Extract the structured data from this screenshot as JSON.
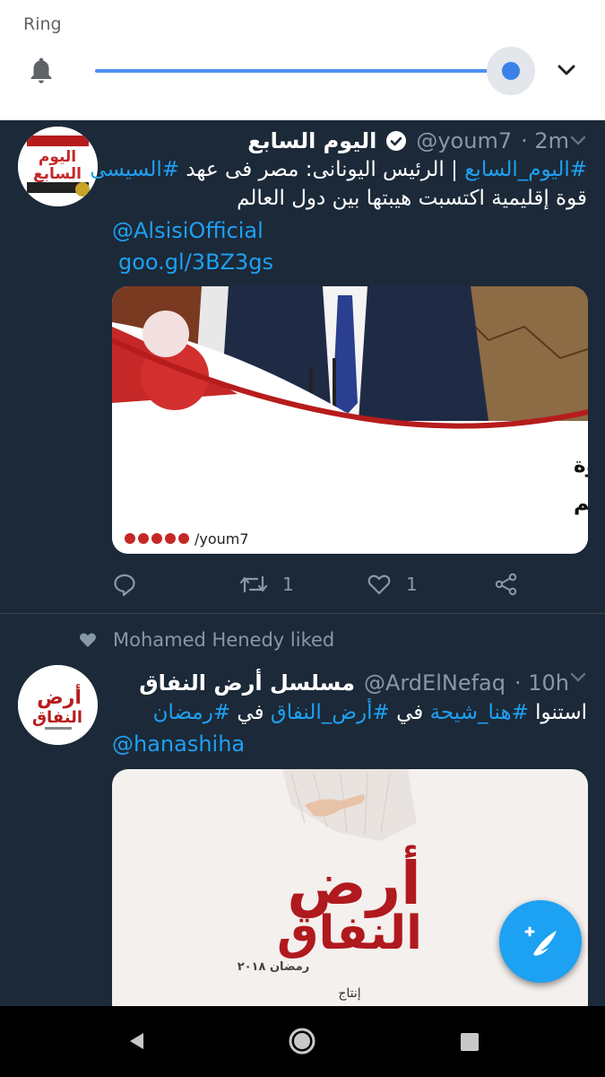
{
  "volume": {
    "label": "Ring",
    "level": 1.0,
    "icons": {
      "bell": "bell-icon",
      "expand": "chevron-down-icon"
    },
    "accent_color": "#3b82e8"
  },
  "tweets": [
    {
      "display_name": "اليوم السابع",
      "verified": true,
      "handle": "@youm7",
      "time": "· 2m",
      "avatar_text_lines": [
        "اليوم",
        "السابع"
      ],
      "hashtag_1": "#اليوم_السابع",
      "text_1": "| الرئيس اليونانى: مصر فى عهد",
      "hashtag_2": "#السيسى",
      "text_line_2": "قوة إقليمية اكتسبت هيبتها بين دول العالم",
      "mention": "@AlsisiOfficial",
      "link": "goo.gl/3BZ3gs",
      "media": {
        "headline_1": "الرئيس اليونانى: مصر فى عهد السيسى قوة",
        "headline_2": "إقليمية اكتسبت هيبتها بين دول العالم",
        "footer": "/youm7"
      },
      "replies": "",
      "retweets": "1",
      "likes": "1"
    },
    {
      "liked_by": "Mohamed Henedy liked",
      "display_name": "مسلسل أرض النفاق",
      "handle": "@ArdElNefaq",
      "time": "· 10h",
      "avatar_text_lines": [
        "أرض",
        "النفاق"
      ],
      "text_1": "استنوا",
      "hashtag_1": "#هنا_شيحة",
      "text_2": "في",
      "hashtag_2": "#أرض_النفاق",
      "text_3": "في",
      "hashtag_3": "#رمضان",
      "mention": "@hanashiha",
      "poster": {
        "title_1": "أرض",
        "title_2": "النفاق",
        "sub": "رمضان ٢٠١٨",
        "credit": "إنتاج"
      }
    }
  ],
  "colors": {
    "background": "#1c2938",
    "link": "#1da1f2",
    "muted": "#8899a6",
    "divider": "#38444d"
  },
  "fab_icon": "compose-tweet-icon",
  "navbar_icons": [
    "back-icon",
    "home-icon",
    "recents-icon"
  ]
}
